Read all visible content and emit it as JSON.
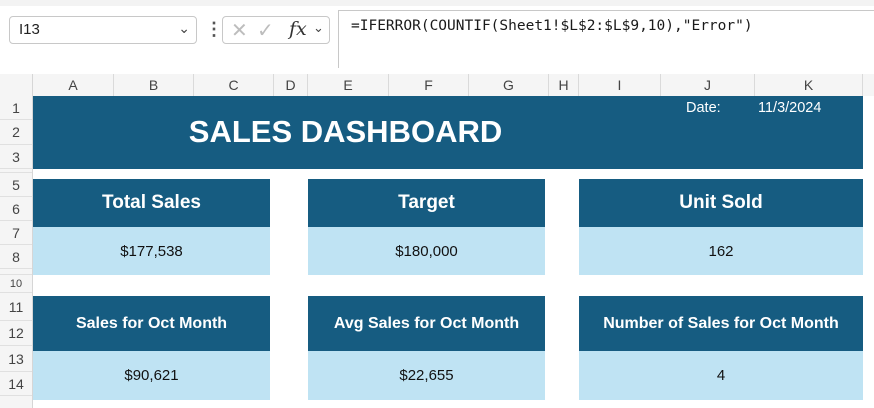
{
  "formula_bar": {
    "name_box": "I13",
    "cancel_icon": "x-icon",
    "enter_icon": "check-icon",
    "function_label": "fx",
    "formula": "=IFERROR(COUNTIF(Sheet1!$L$2:$L$9,10),\"Error\")"
  },
  "columns": [
    "A",
    "B",
    "C",
    "D",
    "E",
    "F",
    "G",
    "H",
    "I",
    "J",
    "K"
  ],
  "rows": [
    "1",
    "2",
    "3",
    "5",
    "6",
    "7",
    "8",
    "10",
    "11",
    "12",
    "13",
    "14"
  ],
  "dashboard": {
    "title": "SALES DASHBOARD",
    "date_label": "Date:",
    "date_value": "11/3/2024",
    "colors": {
      "header_fill": "#165c81",
      "value_fill": "#bfe3f3"
    },
    "cards": [
      {
        "title": "Total Sales",
        "value": "$177,538"
      },
      {
        "title": "Target",
        "value": "$180,000"
      },
      {
        "title": "Unit Sold",
        "value": "162"
      },
      {
        "title": "Sales for Oct Month",
        "value": "$90,621"
      },
      {
        "title": "Avg Sales for Oct Month",
        "value": "$22,655"
      },
      {
        "title": "Number of Sales for Oct Month",
        "value": "4"
      }
    ]
  }
}
